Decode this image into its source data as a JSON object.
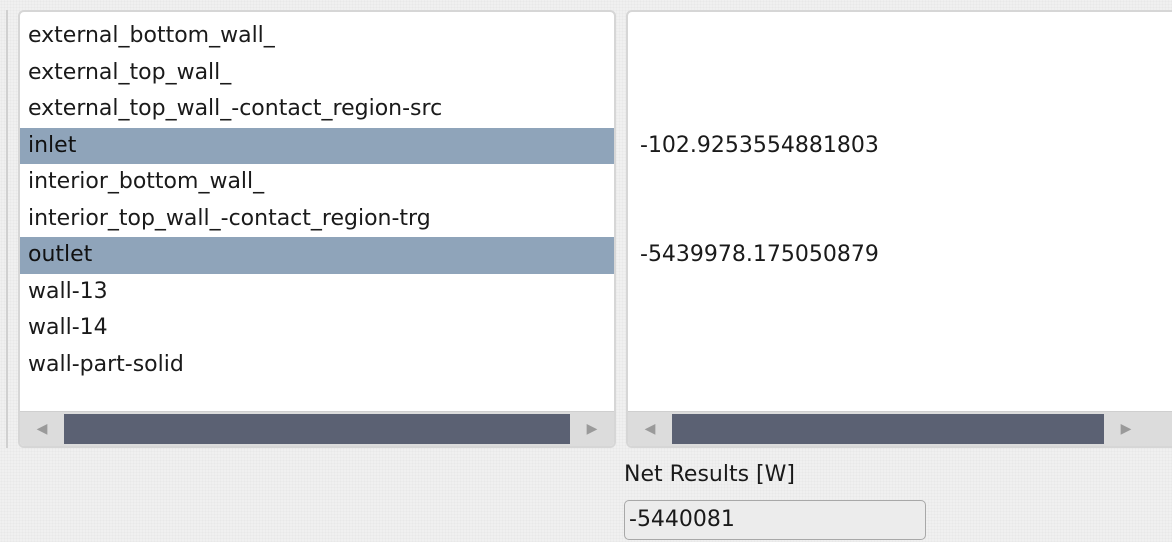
{
  "zones_list": {
    "items": [
      {
        "label": "external_bottom_wall_",
        "selected": false,
        "value": ""
      },
      {
        "label": "external_top_wall_",
        "selected": false,
        "value": ""
      },
      {
        "label": "external_top_wall_-contact_region-src",
        "selected": false,
        "value": ""
      },
      {
        "label": "inlet",
        "selected": true,
        "value": "-102.9253554881803"
      },
      {
        "label": "interior_bottom_wall_",
        "selected": false,
        "value": ""
      },
      {
        "label": "interior_top_wall_-contact_region-trg",
        "selected": false,
        "value": ""
      },
      {
        "label": "outlet",
        "selected": true,
        "value": "-5439978.175050879"
      },
      {
        "label": "wall-13",
        "selected": false,
        "value": ""
      },
      {
        "label": "wall-14",
        "selected": false,
        "value": ""
      },
      {
        "label": "wall-part-solid",
        "selected": false,
        "value": ""
      }
    ]
  },
  "net_results": {
    "label": "Net Results [W]",
    "value": "-5440081"
  },
  "colors": {
    "selection": "#8fa4ba",
    "scroll_thumb": "#5b6173"
  },
  "icons": {
    "scroll_left": "◀",
    "scroll_right": "▶"
  }
}
